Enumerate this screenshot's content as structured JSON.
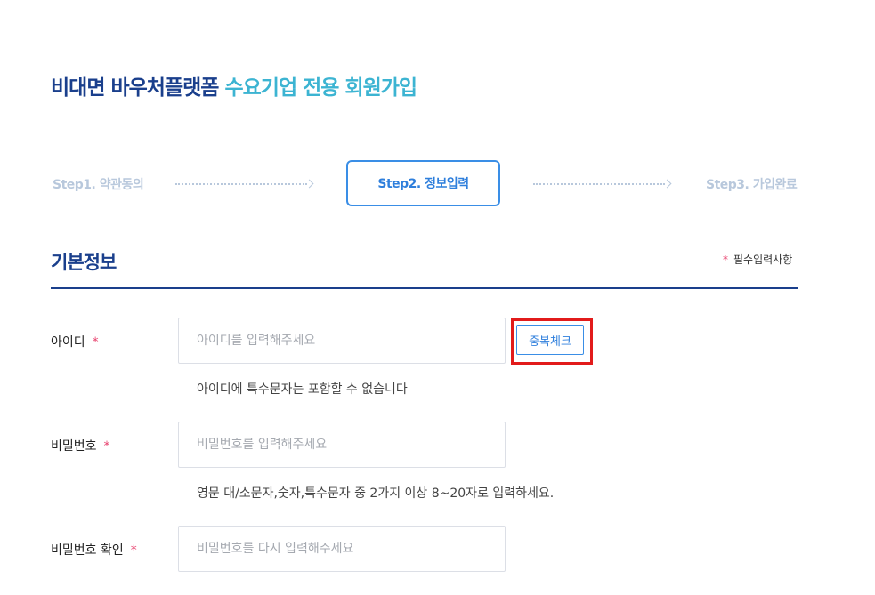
{
  "header": {
    "title_main": "비대면 바우처플랫폼",
    "title_accent": "수요기업 전용 회원가입"
  },
  "steps": [
    {
      "label": "Step1. 약관동의",
      "state": "inactive"
    },
    {
      "label": "Step2. 정보입력",
      "state": "active"
    },
    {
      "label": "Step3. 가입완료",
      "state": "inactive"
    }
  ],
  "section": {
    "title": "기본정보",
    "required_star": "*",
    "required_note": "필수입력사항"
  },
  "form": {
    "id": {
      "label": "아이디",
      "star": "*",
      "value": "",
      "placeholder": "아이디를 입력해주세요",
      "helper": "아이디에 특수문자는 포함할 수 없습니다",
      "check_button": "중복체크"
    },
    "password": {
      "label": "비밀번호",
      "star": "*",
      "value": "",
      "placeholder": "비밀번호를 입력해주세요",
      "helper": "영문 대/소문자,숫자,특수문자 중 2가지 이상 8~20자로 입력하세요."
    },
    "password_confirm": {
      "label": "비밀번호 확인",
      "star": "*",
      "value": "",
      "placeholder": "비밀번호를 다시 입력해주세요"
    }
  },
  "colors": {
    "brand_navy": "#1a3f8c",
    "brand_cyan": "#3cb4d2",
    "active_blue": "#2f7fdc",
    "required_red": "#e8436f",
    "highlight_red": "#e21b1b",
    "inactive_step": "#b8c8dc"
  }
}
